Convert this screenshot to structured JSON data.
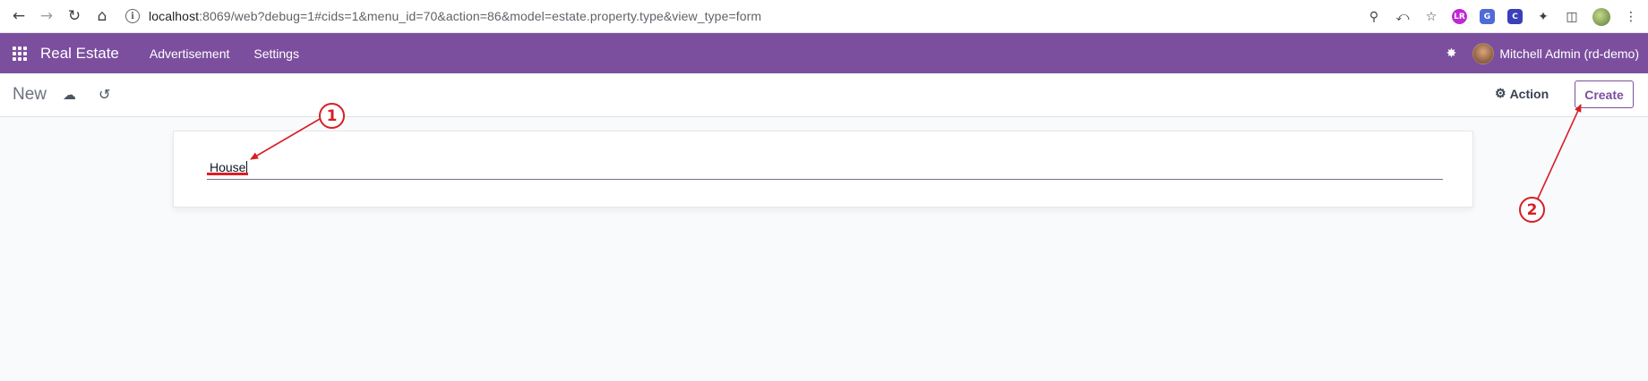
{
  "browser": {
    "url_host": "localhost",
    "url_rest": ":8069/web?debug=1#cids=1&menu_id=70&action=86&model=estate.property.type&view_type=form",
    "ext_labels": [
      "LR",
      "G",
      "C"
    ],
    "colors": {
      "ext_lr": "#c026d3",
      "ext_translate": "#4f6bd8",
      "ext_c": "#3b3fb8"
    }
  },
  "navbar": {
    "brand": "Real Estate",
    "menu": [
      "Advertisement",
      "Settings"
    ],
    "user": "Mitchell Admin (rd-demo)",
    "color": "#7c4f9e"
  },
  "control_panel": {
    "breadcrumb": "New",
    "action_label": "Action",
    "create_label": "Create"
  },
  "form": {
    "name_value": "House"
  },
  "annotations": {
    "step1": "1",
    "step2": "2",
    "color": "#d61f26"
  }
}
